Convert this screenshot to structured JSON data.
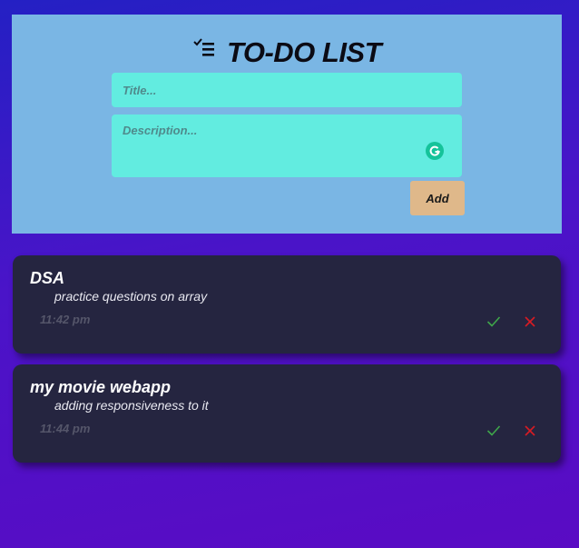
{
  "header": {
    "title": "TO-DO LIST",
    "title_placeholder": "Title...",
    "description_placeholder": "Description...",
    "add_label": "Add"
  },
  "tasks": [
    {
      "title": "DSA",
      "description": "practice questions on array",
      "time": "11:42 pm"
    },
    {
      "title": "my movie webapp",
      "description": "adding responsiveness to it",
      "time": "11:44 pm"
    }
  ],
  "colors": {
    "header_bg": "#7ab6e4",
    "input_bg": "#62ece0",
    "add_button_bg": "#dfb88a",
    "card_bg": "#252540",
    "complete_icon": "#3fa64a",
    "delete_icon": "#d81b24",
    "grammarly": "#15c39a"
  },
  "icons": [
    "checklist-icon",
    "grammarly-icon",
    "check-icon",
    "close-icon"
  ]
}
